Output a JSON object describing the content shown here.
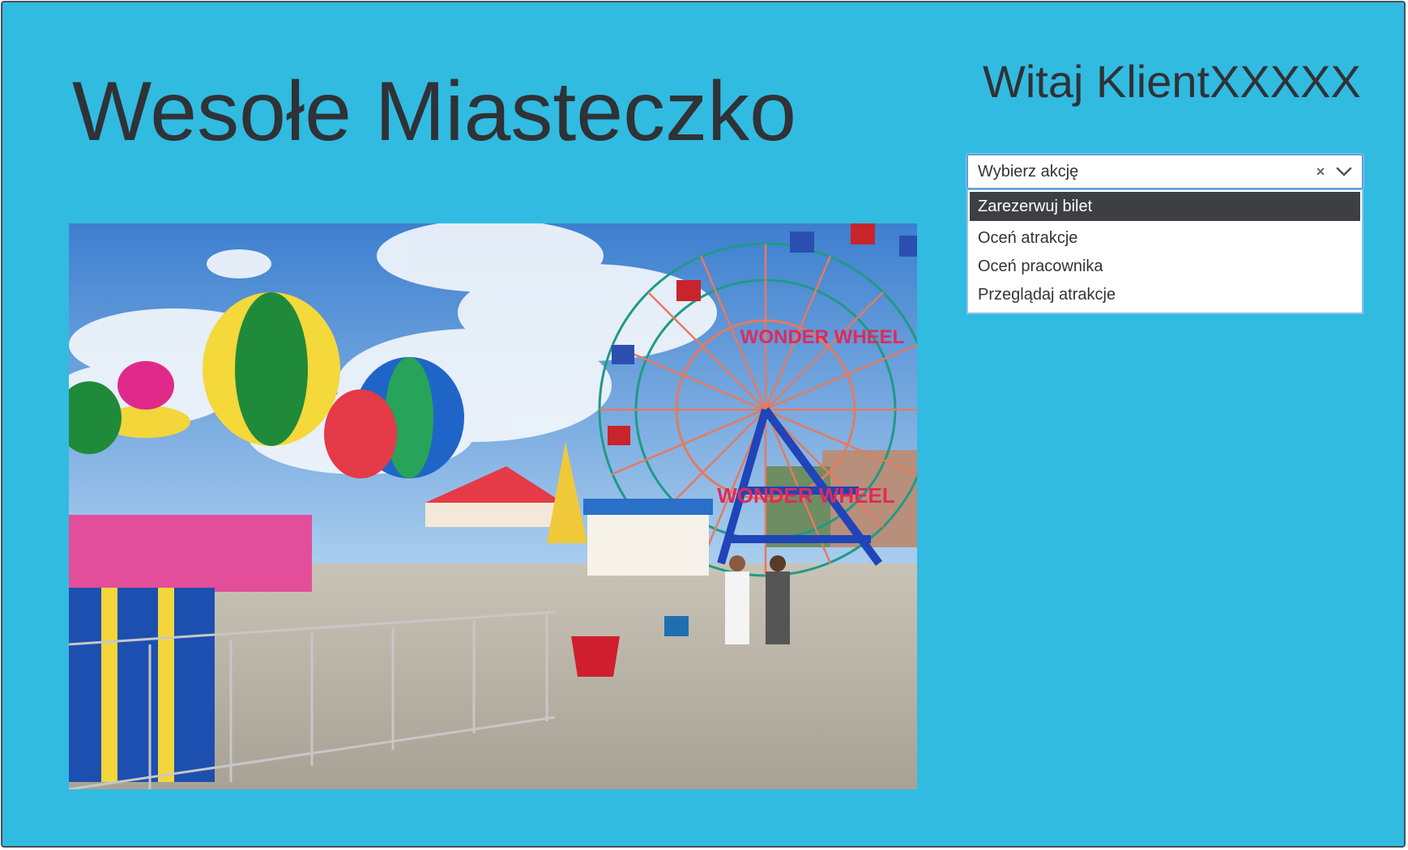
{
  "header": {
    "title": "Wesołe Miasteczko",
    "welcome": "Witaj KlientXXXXX"
  },
  "action_select": {
    "placeholder": "Wybierz akcję",
    "clear_glyph": "×",
    "options": [
      "Zarezerwuj bilet",
      "Oceń atrakcje",
      "Oceń pracownika",
      "Przeglądaj atrakcje"
    ],
    "highlighted_index": 0
  },
  "hero_image": {
    "alt": "amusement park photo",
    "signs": [
      "WONDER WHEEL",
      "WONDER WHEEL"
    ]
  },
  "colors": {
    "background": "#31bbe1",
    "text": "#2f3236",
    "highlight": "#3d3f43",
    "focus_border": "#5b9ddb"
  },
  "icons": {
    "clear": "close-icon",
    "dropdown": "chevron-down-icon"
  }
}
